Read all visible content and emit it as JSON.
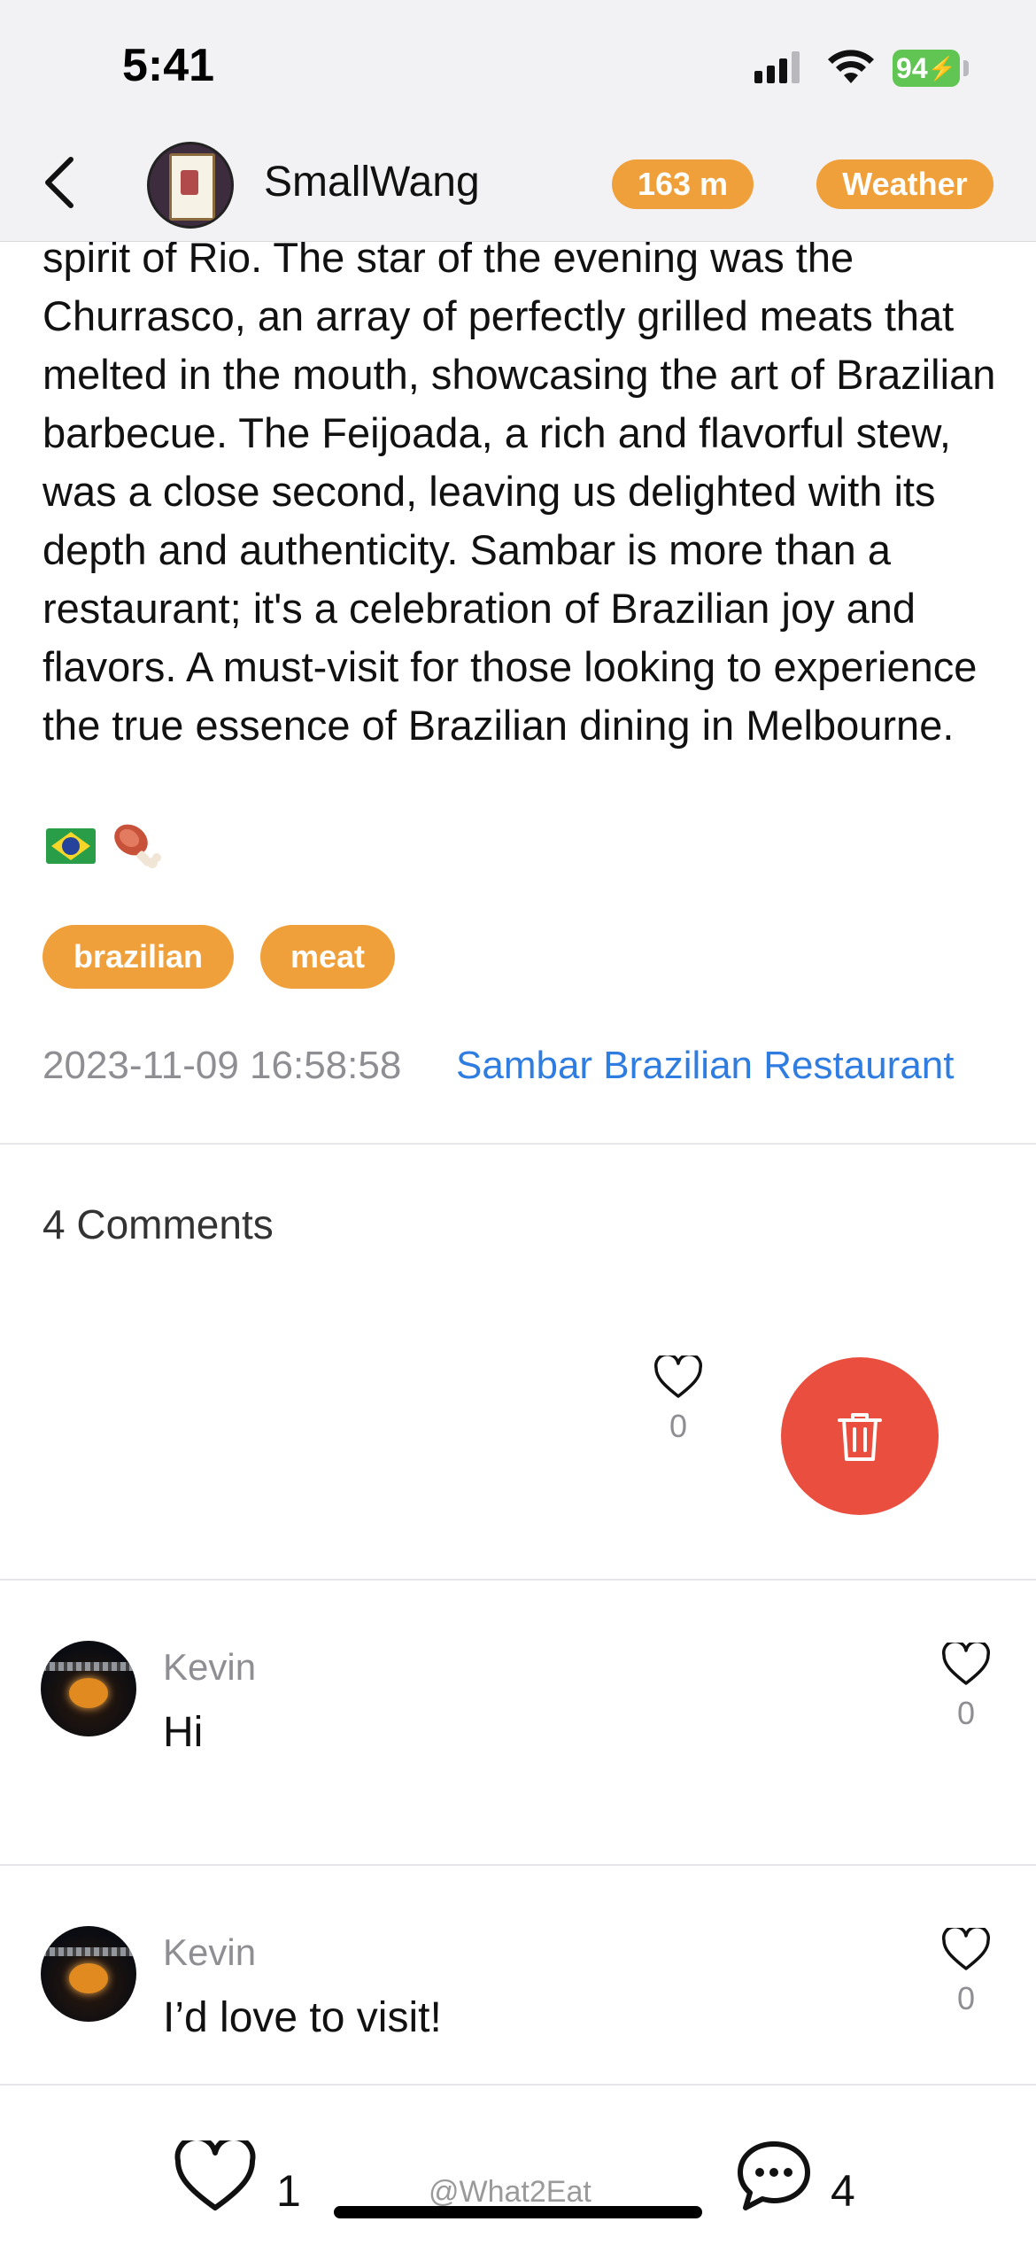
{
  "status_bar": {
    "time": "5:41",
    "battery": "94"
  },
  "header": {
    "username": "SmallWang",
    "distance": "163 m",
    "weather": "Weather"
  },
  "post": {
    "text": "spirit of Rio. The star of the evening was the Churrasco, an array of perfectly grilled meats that melted in the mouth, showcasing the art of Brazilian barbecue. The Feijoada, a rich and flavorful stew, was a close second, leaving us delighted with its depth and authenticity. Sambar is more than a restaurant; it's a celebration of Brazilian joy and flavors. A must-visit for those looking to experience the true essence of Brazilian dining in Melbourne.",
    "emojis": [
      "brazil-flag",
      "meat-on-bone"
    ],
    "tags": [
      "brazilian",
      "meat"
    ],
    "timestamp": "2023-11-09 16:58:58",
    "location": "Sambar Brazilian Restaurant"
  },
  "comments": {
    "title": "4 Comments",
    "own_comment": {
      "likes": "0"
    },
    "items": [
      {
        "name": "Kevin",
        "text": "Hi",
        "likes": "0"
      },
      {
        "name": "Kevin",
        "text": "I’d love to visit!",
        "likes": "0"
      }
    ]
  },
  "bottom_bar": {
    "likes": "1",
    "comments": "4",
    "watermark": "@What2Eat"
  },
  "colors": {
    "accent": "#f0a03a",
    "link": "#2f7de1",
    "delete": "#e94e3f",
    "battery": "#61c554"
  }
}
